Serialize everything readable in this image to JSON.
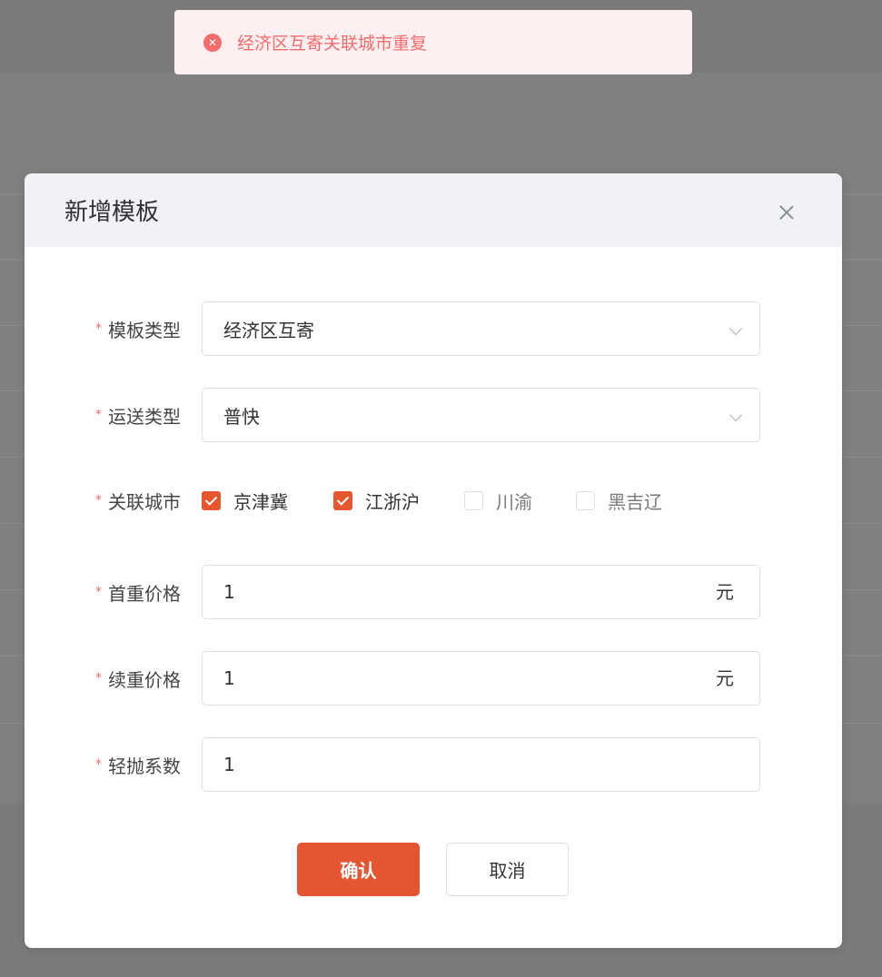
{
  "toast": {
    "icon": "close-circle-icon",
    "text": "经济区互寄关联城市重复"
  },
  "modal": {
    "title": "新增模板",
    "close_icon": "close-icon",
    "fields": {
      "template_type": {
        "label": "模板类型",
        "value": "经济区互寄"
      },
      "shipping_type": {
        "label": "运送类型",
        "value": "普快"
      },
      "cities": {
        "label": "关联城市",
        "options": [
          {
            "label": "京津冀",
            "checked": true
          },
          {
            "label": "江浙沪",
            "checked": true
          },
          {
            "label": "川渝",
            "checked": false
          },
          {
            "label": "黑吉辽",
            "checked": false
          }
        ]
      },
      "first_weight_price": {
        "label": "首重价格",
        "value": "1",
        "unit": "元"
      },
      "extra_weight_price": {
        "label": "续重价格",
        "value": "1",
        "unit": "元"
      },
      "light_factor": {
        "label": "轻抛系数",
        "value": "1"
      }
    },
    "required_mark": "*",
    "confirm_label": "确认",
    "cancel_label": "取消"
  },
  "colors": {
    "accent": "#e45632",
    "error": "#f56c6c",
    "toast_bg": "#fef0f0"
  }
}
